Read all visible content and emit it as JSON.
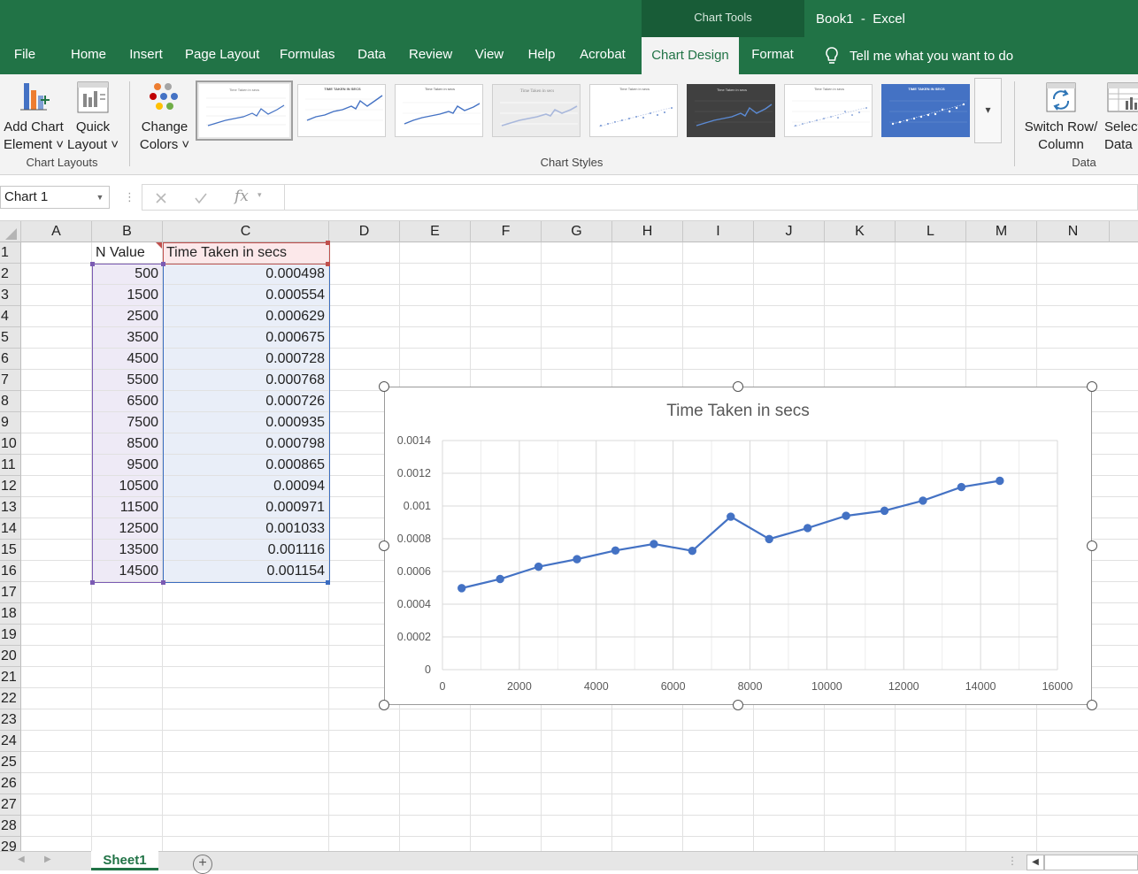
{
  "app": {
    "chart_tools_label": "Chart Tools",
    "document_title": "Book1  -  Excel"
  },
  "quick_access": {
    "save": "save-icon",
    "undo": "undo-icon",
    "redo": "redo-icon",
    "customize": "customize-qat-icon"
  },
  "tabs": [
    {
      "label": "File"
    },
    {
      "label": "Home"
    },
    {
      "label": "Insert"
    },
    {
      "label": "Page Layout"
    },
    {
      "label": "Formulas"
    },
    {
      "label": "Data"
    },
    {
      "label": "Review"
    },
    {
      "label": "View"
    },
    {
      "label": "Help"
    },
    {
      "label": "Acrobat"
    },
    {
      "label": "Chart Design",
      "active": true
    },
    {
      "label": "Format"
    }
  ],
  "tell_me": "Tell me what you want to do",
  "ribbon": {
    "add_chart_element": {
      "line1": "Add Chart",
      "line2": "Element ˅"
    },
    "quick_layout": {
      "line1": "Quick",
      "line2": "Layout ˅"
    },
    "change_colors": {
      "line1": "Change",
      "line2": "Colors ˅"
    },
    "switch_row_column": {
      "line1": "Switch Row/",
      "line2": "Column"
    },
    "select_data": {
      "line1": "Select",
      "line2": "Data"
    },
    "groups": {
      "chart_layouts": "Chart Layouts",
      "chart_styles": "Chart Styles",
      "data": "Data"
    },
    "style_count": 8
  },
  "formula_bar": {
    "name_box": "Chart 1",
    "formula": ""
  },
  "columns": [
    "A",
    "B",
    "C",
    "D",
    "E",
    "F",
    "G",
    "H",
    "I",
    "J",
    "K",
    "L",
    "M",
    "N"
  ],
  "rows": [
    "1",
    "2",
    "3",
    "4",
    "5",
    "6",
    "7",
    "8",
    "9",
    "10",
    "11",
    "12",
    "13",
    "14",
    "15",
    "16",
    "17",
    "18",
    "19",
    "20",
    "21",
    "22",
    "23",
    "24",
    "25",
    "26",
    "27",
    "28",
    "29"
  ],
  "table": {
    "header_b": "N Value",
    "header_c": "Time Taken in secs",
    "n_values": [
      "500",
      "1500",
      "2500",
      "3500",
      "4500",
      "5500",
      "6500",
      "7500",
      "8500",
      "9500",
      "10500",
      "11500",
      "12500",
      "13500",
      "14500"
    ],
    "times": [
      "0.000498",
      "0.000554",
      "0.000629",
      "0.000675",
      "0.000728",
      "0.000768",
      "0.000726",
      "0.000935",
      "0.000798",
      "0.000865",
      "0.00094",
      "0.000971",
      "0.001033",
      "0.001116",
      "0.001154"
    ]
  },
  "sheet": {
    "tab_label": "Sheet1"
  },
  "colors": {
    "excel_green": "#217346",
    "series_blue": "#4472c4"
  },
  "chart_data": {
    "type": "scatter",
    "title": "Time Taken in secs",
    "x": [
      500,
      1500,
      2500,
      3500,
      4500,
      5500,
      6500,
      7500,
      8500,
      9500,
      10500,
      11500,
      12500,
      13500,
      14500
    ],
    "series": [
      {
        "values": [
          0.000498,
          0.000554,
          0.000629,
          0.000675,
          0.000728,
          0.000768,
          0.000726,
          0.000935,
          0.000798,
          0.000865,
          0.00094,
          0.000971,
          0.001033,
          0.001116,
          0.001154
        ]
      }
    ],
    "xlim": [
      0,
      16000
    ],
    "ylim": [
      0,
      0.0014
    ],
    "x_ticks": [
      "0",
      "2000",
      "4000",
      "6000",
      "8000",
      "10000",
      "12000",
      "14000",
      "16000"
    ],
    "y_ticks": [
      "0",
      "0.0002",
      "0.0004",
      "0.0006",
      "0.0008",
      "0.001",
      "0.0012",
      "0.0014"
    ],
    "grid": true,
    "markers": true,
    "lines": "straight"
  }
}
